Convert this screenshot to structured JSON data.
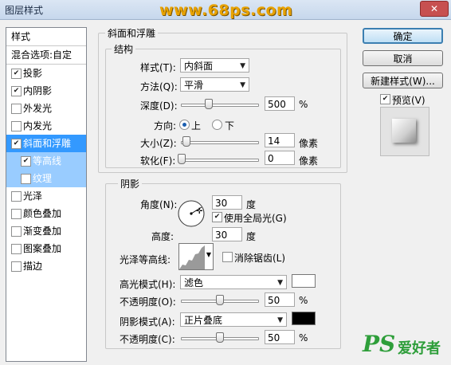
{
  "window": {
    "title": "图层样式",
    "watermark": "www.68ps.com",
    "close_glyph": "✕"
  },
  "sidebar": {
    "header": "样式",
    "blend_options": "混合选项:自定",
    "items": [
      {
        "label": "投影",
        "checked": true
      },
      {
        "label": "内阴影",
        "checked": true
      },
      {
        "label": "外发光",
        "checked": false
      },
      {
        "label": "内发光",
        "checked": false
      },
      {
        "label": "斜面和浮雕",
        "checked": true,
        "selected": true
      },
      {
        "label": "等高线",
        "checked": true,
        "sub": true
      },
      {
        "label": "纹理",
        "checked": false,
        "sub": true
      },
      {
        "label": "光泽",
        "checked": false
      },
      {
        "label": "颜色叠加",
        "checked": false
      },
      {
        "label": "渐变叠加",
        "checked": false
      },
      {
        "label": "图案叠加",
        "checked": false
      },
      {
        "label": "描边",
        "checked": false
      }
    ]
  },
  "bevel": {
    "section_title": "斜面和浮雕",
    "structure": {
      "title": "结构",
      "style_label": "样式(T):",
      "style_value": "内斜面",
      "technique_label": "方法(Q):",
      "technique_value": "平滑",
      "depth_label": "深度(D):",
      "depth_value": "500",
      "depth_unit": "%",
      "depth_pos": 0.35,
      "direction_label": "方向:",
      "dir_up": "上",
      "dir_down": "下",
      "size_label": "大小(Z):",
      "size_value": "14",
      "size_unit": "像素",
      "size_pos": 0.06,
      "soften_label": "软化(F):",
      "soften_value": "0",
      "soften_unit": "像素",
      "soften_pos": 0.0
    },
    "shading": {
      "title": "阴影",
      "angle_label": "角度(N):",
      "angle_value": "30",
      "angle_unit": "度",
      "global_light_label": "使用全局光(G)",
      "altitude_label": "高度:",
      "altitude_value": "30",
      "altitude_unit": "度",
      "gloss_contour_label": "光泽等高线:",
      "antialias_label": "消除锯齿(L)",
      "highlight_mode_label": "高光模式(H):",
      "highlight_mode_value": "滤色",
      "highlight_color": "#ffffff",
      "highlight_opacity_label": "不透明度(O):",
      "highlight_opacity_value": "50",
      "highlight_opacity_unit": "%",
      "highlight_opacity_pos": 0.5,
      "shadow_mode_label": "阴影模式(A):",
      "shadow_mode_value": "正片叠底",
      "shadow_color": "#000000",
      "shadow_opacity_label": "不透明度(C):",
      "shadow_opacity_value": "50",
      "shadow_opacity_unit": "%",
      "shadow_opacity_pos": 0.5
    }
  },
  "buttons": {
    "ok": "确定",
    "cancel": "取消",
    "new_style": "新建样式(W)...",
    "preview": "预览(V)"
  },
  "logo": {
    "text_ps": "PS",
    "text_cn": "爱好者"
  }
}
